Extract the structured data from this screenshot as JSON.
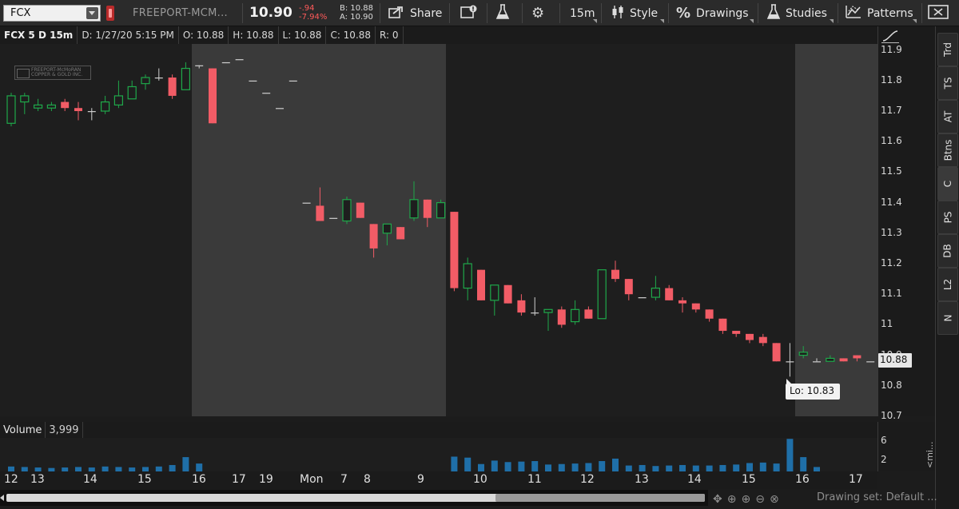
{
  "toolbar": {
    "symbol": "FCX",
    "company": "FREEPORT-MCM...",
    "last": "10.90",
    "change": "-.94",
    "change_pct": "-7.94%",
    "bid": "B: 10.88",
    "ask": "A: 10.90",
    "share_label": "Share",
    "timeframe": "15m",
    "style_label": "Style",
    "drawings_label": "Drawings",
    "studies_label": "Studies",
    "patterns_label": "Patterns"
  },
  "info": {
    "title": "FCX 5 D 15m",
    "date": "D: 1/27/20 5:15 PM",
    "open": "O: 10.88",
    "high": "H: 10.88",
    "low": "L: 10.88",
    "close": "C: 10.88",
    "range": "R: 0"
  },
  "logo_text": "FREEPORT-McMoRAN COPPER & GOLD INC.",
  "price_axis": {
    "labels": [
      "11.9",
      "11.8",
      "11.7",
      "11.6",
      "11.5",
      "11.4",
      "11.3",
      "11.2",
      "11.1",
      "11",
      "10.9",
      "10.8",
      "10.7"
    ],
    "current": "10.88",
    "low_tag": "Lo: 10.83"
  },
  "side_tabs": [
    "Trd",
    "TS",
    "AT",
    "Btns",
    "C",
    "PS",
    "DB",
    "L2",
    "N"
  ],
  "volume": {
    "label": "Volume",
    "value": "3,999",
    "axis": [
      "6",
      "2"
    ],
    "mini": "<mi..."
  },
  "time_axis": [
    "12",
    "13",
    "14",
    "15",
    "16",
    "17",
    "19",
    "Mon",
    "7",
    "8",
    "9",
    "10",
    "11",
    "12",
    "13",
    "14",
    "15",
    "16",
    "17"
  ],
  "footer": {
    "drawing_set": "Drawing set: Default ..."
  },
  "colors": {
    "up": "#1fa84a",
    "down": "#f25c66",
    "volume": "#1f6fa8",
    "session": "#3a3a3a"
  },
  "chart_data": {
    "type": "candlestick",
    "ylim": [
      10.7,
      11.92
    ],
    "candles": [
      {
        "o": 11.66,
        "h": 11.76,
        "l": 11.65,
        "c": 11.75
      },
      {
        "o": 11.73,
        "h": 11.76,
        "l": 11.69,
        "c": 11.75
      },
      {
        "o": 11.71,
        "h": 11.74,
        "l": 11.7,
        "c": 11.72
      },
      {
        "o": 11.71,
        "h": 11.73,
        "l": 11.7,
        "c": 11.72
      },
      {
        "o": 11.73,
        "h": 11.74,
        "l": 11.7,
        "c": 11.71
      },
      {
        "o": 11.71,
        "h": 11.73,
        "l": 11.67,
        "c": 11.7
      },
      {
        "o": 11.7,
        "h": 11.71,
        "l": 11.67,
        "c": 11.7
      },
      {
        "o": 11.7,
        "h": 11.75,
        "l": 11.69,
        "c": 11.73
      },
      {
        "o": 11.72,
        "h": 11.8,
        "l": 11.71,
        "c": 11.75
      },
      {
        "o": 11.74,
        "h": 11.8,
        "l": 11.74,
        "c": 11.78
      },
      {
        "o": 11.79,
        "h": 11.82,
        "l": 11.77,
        "c": 11.81
      },
      {
        "o": 11.81,
        "h": 11.84,
        "l": 11.8,
        "c": 11.81
      },
      {
        "o": 11.81,
        "h": 11.82,
        "l": 11.74,
        "c": 11.75
      },
      {
        "o": 11.77,
        "h": 11.86,
        "l": 11.77,
        "c": 11.84
      },
      {
        "o": 11.85,
        "h": 11.85,
        "l": 11.84,
        "c": 11.85
      },
      {
        "o": 11.84,
        "h": 11.84,
        "l": 11.66,
        "c": 11.66
      },
      {
        "o": 11.86,
        "h": 11.86,
        "l": 11.86,
        "c": 11.86
      },
      {
        "o": 11.87,
        "h": 11.87,
        "l": 11.87,
        "c": 11.87
      },
      {
        "o": 11.8,
        "h": 11.8,
        "l": 11.8,
        "c": 11.8
      },
      {
        "o": 11.76,
        "h": 11.76,
        "l": 11.76,
        "c": 11.76
      },
      {
        "o": 11.71,
        "h": 11.71,
        "l": 11.71,
        "c": 11.71
      },
      {
        "o": 11.8,
        "h": 11.8,
        "l": 11.8,
        "c": 11.8
      },
      {
        "o": 11.4,
        "h": 11.4,
        "l": 11.4,
        "c": 11.4
      },
      {
        "o": 11.39,
        "h": 11.45,
        "l": 11.34,
        "c": 11.34
      },
      {
        "o": 11.35,
        "h": 11.35,
        "l": 11.35,
        "c": 11.35
      },
      {
        "o": 11.34,
        "h": 11.42,
        "l": 11.33,
        "c": 11.41
      },
      {
        "o": 11.4,
        "h": 11.4,
        "l": 11.35,
        "c": 11.35
      },
      {
        "o": 11.33,
        "h": 11.33,
        "l": 11.22,
        "c": 11.25
      },
      {
        "o": 11.3,
        "h": 11.33,
        "l": 11.26,
        "c": 11.33
      },
      {
        "o": 11.32,
        "h": 11.32,
        "l": 11.28,
        "c": 11.28
      },
      {
        "o": 11.35,
        "h": 11.47,
        "l": 11.34,
        "c": 11.41
      },
      {
        "o": 11.41,
        "h": 11.41,
        "l": 11.32,
        "c": 11.35
      },
      {
        "o": 11.35,
        "h": 11.41,
        "l": 11.35,
        "c": 11.4
      },
      {
        "o": 11.37,
        "h": 11.37,
        "l": 11.11,
        "c": 11.12
      },
      {
        "o": 11.12,
        "h": 11.22,
        "l": 11.08,
        "c": 11.2
      },
      {
        "o": 11.18,
        "h": 11.18,
        "l": 11.08,
        "c": 11.08
      },
      {
        "o": 11.08,
        "h": 11.13,
        "l": 11.03,
        "c": 11.13
      },
      {
        "o": 11.13,
        "h": 11.13,
        "l": 11.07,
        "c": 11.07
      },
      {
        "o": 11.08,
        "h": 11.1,
        "l": 11.03,
        "c": 11.04
      },
      {
        "o": 11.04,
        "h": 11.09,
        "l": 11.03,
        "c": 11.04
      },
      {
        "o": 11.04,
        "h": 11.05,
        "l": 10.98,
        "c": 11.05
      },
      {
        "o": 11.05,
        "h": 11.06,
        "l": 10.99,
        "c": 11.0
      },
      {
        "o": 11.01,
        "h": 11.08,
        "l": 11.0,
        "c": 11.05
      },
      {
        "o": 11.05,
        "h": 11.06,
        "l": 11.02,
        "c": 11.02
      },
      {
        "o": 11.02,
        "h": 11.18,
        "l": 11.02,
        "c": 11.18
      },
      {
        "o": 11.18,
        "h": 11.21,
        "l": 11.14,
        "c": 11.15
      },
      {
        "o": 11.15,
        "h": 11.15,
        "l": 11.08,
        "c": 11.1
      },
      {
        "o": 11.09,
        "h": 11.09,
        "l": 11.09,
        "c": 11.09
      },
      {
        "o": 11.09,
        "h": 11.16,
        "l": 11.08,
        "c": 11.12
      },
      {
        "o": 11.12,
        "h": 11.13,
        "l": 11.08,
        "c": 11.08
      },
      {
        "o": 11.08,
        "h": 11.09,
        "l": 11.04,
        "c": 11.07
      },
      {
        "o": 11.07,
        "h": 11.07,
        "l": 11.04,
        "c": 11.05
      },
      {
        "o": 11.05,
        "h": 11.05,
        "l": 11.01,
        "c": 11.02
      },
      {
        "o": 11.02,
        "h": 11.02,
        "l": 10.97,
        "c": 10.98
      },
      {
        "o": 10.98,
        "h": 10.98,
        "l": 10.96,
        "c": 10.97
      },
      {
        "o": 10.97,
        "h": 10.97,
        "l": 10.94,
        "c": 10.95
      },
      {
        "o": 10.96,
        "h": 10.97,
        "l": 10.93,
        "c": 10.94
      },
      {
        "o": 10.94,
        "h": 10.94,
        "l": 10.88,
        "c": 10.88
      },
      {
        "o": 10.88,
        "h": 10.94,
        "l": 10.83,
        "c": 10.88
      },
      {
        "o": 10.9,
        "h": 10.93,
        "l": 10.89,
        "c": 10.91
      },
      {
        "o": 10.88,
        "h": 10.89,
        "l": 10.88,
        "c": 10.88
      },
      {
        "o": 10.88,
        "h": 10.9,
        "l": 10.88,
        "c": 10.89
      },
      {
        "o": 10.89,
        "h": 10.89,
        "l": 10.88,
        "c": 10.88
      },
      {
        "o": 10.9,
        "h": 10.9,
        "l": 10.88,
        "c": 10.89
      },
      {
        "o": 10.88,
        "h": 10.88,
        "l": 10.88,
        "c": 10.88
      }
    ],
    "volume_ylim": [
      0,
      6.8
    ],
    "volumes": [
      1.0,
      0.9,
      0.8,
      0.7,
      0.8,
      0.9,
      0.8,
      1.0,
      0.9,
      0.8,
      0.9,
      1.0,
      1.3,
      2.9,
      1.6,
      0,
      0,
      0,
      0,
      0,
      0,
      0,
      0,
      0,
      0,
      0,
      0,
      0,
      0,
      0,
      0,
      0,
      0,
      3.0,
      2.8,
      1.5,
      2.2,
      1.9,
      2.0,
      2.1,
      1.4,
      1.5,
      1.6,
      1.7,
      2.1,
      2.6,
      1.2,
      1.3,
      1.1,
      1.2,
      1.3,
      1.2,
      1.2,
      1.3,
      1.4,
      1.7,
      1.8,
      1.6,
      6.6,
      2.9,
      0.9,
      0,
      0,
      0,
      0
    ]
  }
}
